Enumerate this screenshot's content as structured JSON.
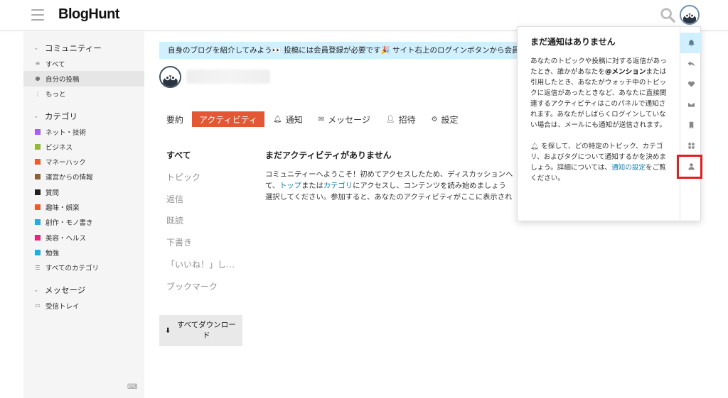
{
  "header": {
    "logo": "BlogHunt"
  },
  "sidebar": {
    "community_section": "コミュニティー",
    "community_items": [
      {
        "label": "すべて",
        "icon": "layers-icon"
      },
      {
        "label": "自分の投稿",
        "icon": "user-icon",
        "active": true
      },
      {
        "label": "もっと",
        "icon": "vertical-dots-icon"
      }
    ],
    "category_section": "カテゴリ",
    "categories": [
      {
        "label": "ネット・技術",
        "color": "#a461ef"
      },
      {
        "label": "ビジネス",
        "color": "#92b83a"
      },
      {
        "label": "マネーハック",
        "color": "#f1592a"
      },
      {
        "label": "運営からの情報",
        "color": "#8c6238"
      },
      {
        "label": "質問",
        "color": "#231f20"
      },
      {
        "label": "趣味・娯楽",
        "color": "#f7941d"
      },
      {
        "label": "創作・モノ書き",
        "color": "#25aae1"
      },
      {
        "label": "美容・ヘルス",
        "color": "#ed207b"
      },
      {
        "label": "勉強",
        "color": "#3ab0e2"
      }
    ],
    "all_categories": "すべてのカテゴリ",
    "message_section": "メッセージ",
    "inbox": "受信トレイ"
  },
  "banner": {
    "text": "自身のブログを紹介してみよう👀 投稿には会員登録が必要です🎉 サイト右上のログインボタンから会員"
  },
  "profile_nav": {
    "items": [
      {
        "label": "要約",
        "icon": ""
      },
      {
        "label": "アクティビティ",
        "icon": "",
        "active": true
      },
      {
        "label": "通知",
        "icon": "bell-icon"
      },
      {
        "label": "メッセージ",
        "icon": "envelope-icon"
      },
      {
        "label": "招待",
        "icon": "user-plus-icon"
      },
      {
        "label": "設定",
        "icon": "gear-icon"
      }
    ]
  },
  "activity_filters": [
    "すべて",
    "トピック",
    "返信",
    "既読",
    "下書き",
    "「いいね！」し…",
    "ブックマーク"
  ],
  "download_button": "すべてダウンロード",
  "activity": {
    "title": "まだアクティビティがありません",
    "body_1": "コミュニティーへようこそ！初めてアクセスしたため、ディスカッションへ",
    "body_2": "て、",
    "link_top": "トップ",
    "body_3": "または",
    "link_category": "カテゴリ",
    "body_4": "にアクセスし、コンテンツを読み始めましょう",
    "body_5": "選択してください。参加すると、あなたのアクティビティがここに表示され"
  },
  "notification_panel": {
    "title": "まだ通知はありません",
    "p1_a": "あなたのトピックや投稿に対する返信があったとき、誰かがあなたを",
    "p1_mention": "@メンション",
    "p1_b": "または引用したとき、あなたがウォッチ中のトピックに返信があったときなど、あなたに直接関連するアクティビティはこのパネルで通知されます。あなたがしばらくログインしていない場合は、メールにも通知が送信されます。",
    "p2_a": "を探して、どの特定のトピック、カテゴリ、およびタグについて通知するかを決めましょう。詳細については、",
    "p2_link": "通知の設定",
    "p2_b": "をご覧ください。",
    "rail": [
      "bell-icon",
      "reply-icon",
      "heart-icon",
      "envelope-icon",
      "bookmark-icon",
      "grid-icon",
      "user-icon"
    ]
  }
}
